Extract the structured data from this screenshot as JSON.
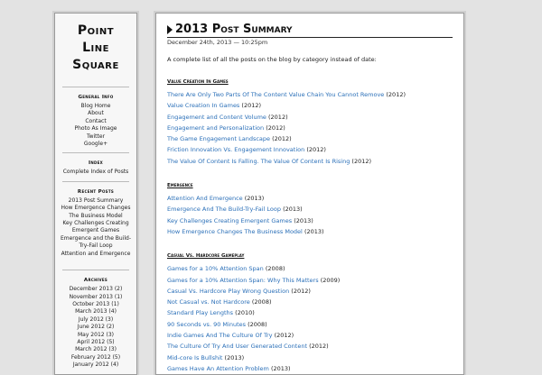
{
  "sidebar": {
    "site_title": [
      "Point",
      "Line",
      "Square"
    ],
    "general_info": {
      "heading": "General Info",
      "links": [
        "Blog Home",
        "About",
        "Contact",
        "Photo As Image",
        "Twitter",
        "Google+"
      ]
    },
    "index": {
      "heading": "Index",
      "links": [
        "Complete Index of Posts"
      ]
    },
    "recent_posts": {
      "heading": "Recent Posts",
      "links": [
        "2013 Post Summary",
        "How Emergence Changes The Business Model",
        "Key Challenges Creating Emergent Games",
        "Emergence and the Build-Try-Fail Loop",
        "Attention and Emergence"
      ]
    },
    "archives": {
      "heading": "Archives",
      "links": [
        "December 2013 (2)",
        "November 2013 (1)",
        "October 2013 (1)",
        "March 2013 (4)",
        "July 2012 (3)",
        "June 2012 (2)",
        "May 2012 (3)",
        "April 2012 (5)",
        "March 2012 (3)",
        "February 2012 (5)",
        "January 2012 (4)"
      ]
    }
  },
  "main": {
    "title": "2013 Post Summary",
    "date": "December 24th, 2013 — 10:25pm",
    "intro": "A complete list of all the posts on the blog by category instead of date:",
    "categories": [
      {
        "name": "Value Creation In Games",
        "posts": [
          {
            "title": "There Are Only Two Parts Of The Content Value Chain You Cannot Remove",
            "year": "(2012)"
          },
          {
            "title": "Value Creation In Games",
            "year": "(2012)"
          },
          {
            "title": "Engagement and Content Volume",
            "year": "(2012)"
          },
          {
            "title": "Engagement and Personalization",
            "year": "(2012)"
          },
          {
            "title": "The Game Engagement Landscape",
            "year": "(2012)"
          },
          {
            "title": "Friction Innovation Vs. Engagement Innovation",
            "year": "(2012)"
          },
          {
            "title": "The Value Of Content Is Falling. The Value Of Content Is Rising",
            "year": "(2012)"
          }
        ]
      },
      {
        "name": "Emergence",
        "posts": [
          {
            "title": "Attention And Emergence",
            "year": "(2013)"
          },
          {
            "title": "Emergence And The Build-Try-Fail Loop",
            "year": "(2013)"
          },
          {
            "title": "Key Challenges Creating Emergent Games",
            "year": "(2013)"
          },
          {
            "title": "How Emergence Changes The Business Model",
            "year": "(2013)"
          }
        ]
      },
      {
        "name": "Casual Vs. Hardcore Gameplay",
        "posts": [
          {
            "title": "Games for a 10% Attention Span",
            "year": "(2008)"
          },
          {
            "title": "Games for a 10% Attention Span:  Why This Matters",
            "year": "(2009)"
          },
          {
            "title": "Casual Vs. Hardcore Play  Wrong Question",
            "year": "(2012)"
          },
          {
            "title": "Not Casual vs. Not Hardcore",
            "year": "(2008)"
          },
          {
            "title": "Standard Play Lengths",
            "year": "(2010)"
          },
          {
            "title": "90 Seconds vs. 90 Minutes",
            "year": "(2008)"
          },
          {
            "title": "Indie Games And The Culture Of Try",
            "year": "(2012)"
          },
          {
            "title": "The Culture Of Try And User Generated Content",
            "year": "(2012)"
          },
          {
            "title": "Mid-core Is Bullshit",
            "year": "(2013)"
          },
          {
            "title": "Games Have An Attention Problem",
            "year": "(2013)"
          }
        ]
      }
    ]
  },
  "colors": {
    "page_background": "#e3e3e3",
    "panel_background": "#ffffff",
    "link": "#2a6fb8",
    "text": "#222222"
  },
  "icons": {
    "title_marker": "triangle-right-icon"
  }
}
